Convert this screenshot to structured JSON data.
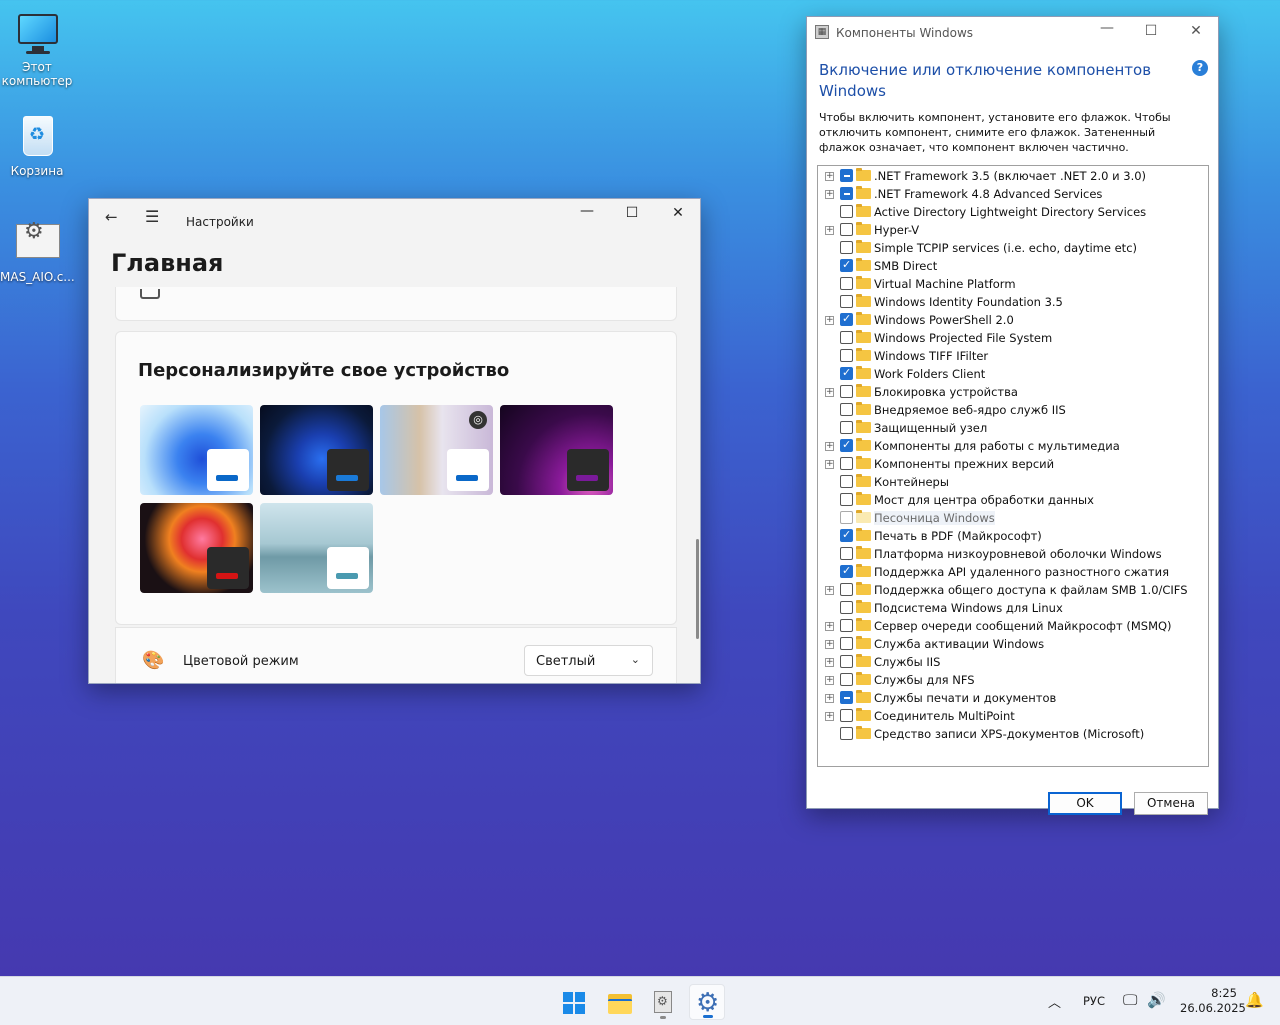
{
  "desktop": {
    "icons": [
      {
        "label": "Этот компьютер",
        "icon": "monitor-icon"
      },
      {
        "label": "Корзина",
        "icon": "recycle-bin-icon"
      },
      {
        "label": "MAS_AIO.c...",
        "icon": "script-file-icon"
      }
    ]
  },
  "settings": {
    "title": "Настройки",
    "heading": "Главная",
    "personalize_title": "Персонализируйте свое устройство",
    "themes": [
      {
        "name": "bloom-light",
        "bg": "#7cc2f0",
        "accent": "#0a68c8",
        "chip": "#ffffff"
      },
      {
        "name": "bloom-dark",
        "bg": "#0b1a3a",
        "accent": "#1a7ad8",
        "chip": "#2a2a2a"
      },
      {
        "name": "spotlight",
        "bg": "#c8b6a8",
        "accent": "#0a68c8",
        "chip": "#ffffff"
      },
      {
        "name": "glow",
        "bg": "#3a0a3a",
        "accent": "#7a1a9a",
        "chip": "#2a2a2a"
      },
      {
        "name": "captured-motion",
        "bg": "#1a1014",
        "accent": "#d41414",
        "chip": "#2a2a2a"
      },
      {
        "name": "flow",
        "bg": "#8ab6c4",
        "accent": "#4a9ab0",
        "chip": "#ffffff"
      }
    ],
    "color_mode_label": "Цветовой режим",
    "color_mode_value": "Светлый"
  },
  "features": {
    "window_title": "Компоненты Windows",
    "heading": "Включение или отключение компонентов Windows",
    "description": "Чтобы включить компонент, установите его флажок. Чтобы отключить компонент, снимите его флажок. Затененный флажок означает, что компонент включен частично.",
    "items": [
      {
        "label": ".NET Framework 3.5 (включает .NET 2.0 и 3.0)",
        "state": "partial",
        "expandable": true
      },
      {
        "label": ".NET Framework 4.8 Advanced Services",
        "state": "partial",
        "expandable": true
      },
      {
        "label": "Active Directory Lightweight Directory Services",
        "state": "unchecked",
        "expandable": false
      },
      {
        "label": "Hyper-V",
        "state": "unchecked",
        "expandable": true
      },
      {
        "label": "Simple TCPIP services (i.e. echo, daytime etc)",
        "state": "unchecked",
        "expandable": false
      },
      {
        "label": "SMB Direct",
        "state": "checked",
        "expandable": false
      },
      {
        "label": "Virtual Machine Platform",
        "state": "unchecked",
        "expandable": false
      },
      {
        "label": "Windows Identity Foundation 3.5",
        "state": "unchecked",
        "expandable": false
      },
      {
        "label": "Windows PowerShell 2.0",
        "state": "checked",
        "expandable": true
      },
      {
        "label": "Windows Projected File System",
        "state": "unchecked",
        "expandable": false
      },
      {
        "label": "Windows TIFF IFilter",
        "state": "unchecked",
        "expandable": false
      },
      {
        "label": "Work Folders Client",
        "state": "checked",
        "expandable": false
      },
      {
        "label": "Блокировка устройства",
        "state": "unchecked",
        "expandable": true
      },
      {
        "label": "Внедряемое веб-ядро служб IIS",
        "state": "unchecked",
        "expandable": false
      },
      {
        "label": "Защищенный узел",
        "state": "unchecked",
        "expandable": false
      },
      {
        "label": "Компоненты для работы с мультимедиа",
        "state": "checked",
        "expandable": true
      },
      {
        "label": "Компоненты прежних версий",
        "state": "unchecked",
        "expandable": true
      },
      {
        "label": "Контейнеры",
        "state": "unchecked",
        "expandable": false
      },
      {
        "label": "Мост для центра обработки данных",
        "state": "unchecked",
        "expandable": false
      },
      {
        "label": "Песочница Windows",
        "state": "disabled",
        "expandable": false
      },
      {
        "label": "Печать в PDF (Майкрософт)",
        "state": "checked",
        "expandable": false
      },
      {
        "label": "Платформа низкоуровневой оболочки Windows",
        "state": "unchecked",
        "expandable": false
      },
      {
        "label": "Поддержка API удаленного разностного сжатия",
        "state": "checked",
        "expandable": false
      },
      {
        "label": "Поддержка общего доступа к файлам SMB 1.0/CIFS",
        "state": "unchecked",
        "expandable": true
      },
      {
        "label": "Подсистема Windows для Linux",
        "state": "unchecked",
        "expandable": false
      },
      {
        "label": "Сервер очереди сообщений Майкрософт (MSMQ)",
        "state": "unchecked",
        "expandable": true
      },
      {
        "label": "Служба активации Windows",
        "state": "unchecked",
        "expandable": true
      },
      {
        "label": "Службы IIS",
        "state": "unchecked",
        "expandable": true
      },
      {
        "label": "Службы для NFS",
        "state": "unchecked",
        "expandable": true
      },
      {
        "label": "Службы печати и документов",
        "state": "partial",
        "expandable": true
      },
      {
        "label": "Соединитель MultiPoint",
        "state": "unchecked",
        "expandable": true
      },
      {
        "label": "Средство записи XPS-документов (Microsoft)",
        "state": "unchecked",
        "expandable": false
      }
    ],
    "ok_label": "OK",
    "cancel_label": "Отмена"
  },
  "taskbar": {
    "apps": [
      "start-icon",
      "file-explorer-icon",
      "control-panel-icon",
      "settings-icon"
    ],
    "language": "РУС",
    "time": "8:25",
    "date": "26.06.2025"
  }
}
